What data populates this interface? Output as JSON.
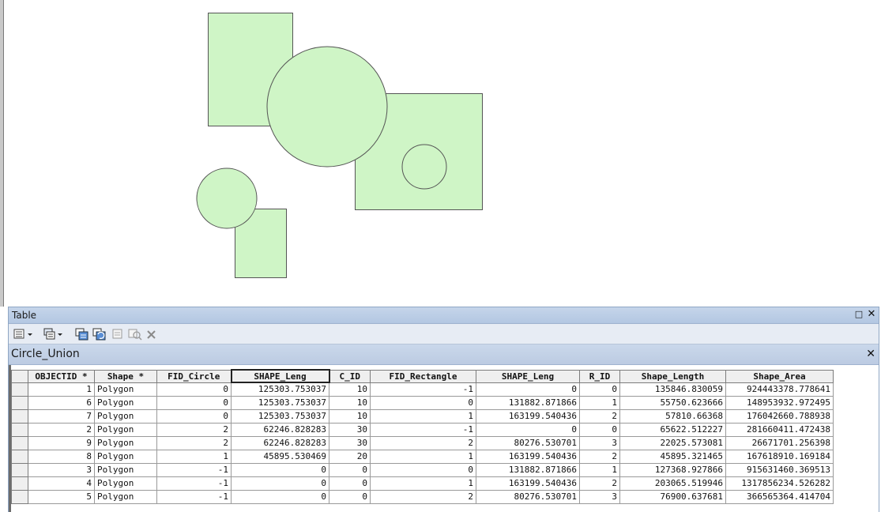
{
  "window": {
    "title": "Table",
    "maximize_glyph": "□",
    "close_glyph": "✕"
  },
  "toolbar": {
    "icons": [
      "table-options-icon",
      "related-tables-icon",
      "select-by-attributes-icon",
      "switch-selection-icon",
      "clear-selection-icon",
      "zoom-to-selected-icon",
      "delete-selected-icon"
    ]
  },
  "tab": {
    "title": "Circle_Union",
    "close_glyph": "✕"
  },
  "map": {
    "fill_color": "#cff5c6",
    "stroke_color": "#555555"
  },
  "table": {
    "columns": [
      "OBJECTID *",
      "Shape *",
      "FID_Circle",
      "SHAPE_Leng",
      "C_ID",
      "FID_Rectangle",
      "SHAPE_Leng",
      "R_ID",
      "Shape_Length",
      "Shape_Area"
    ],
    "selected_column": 3,
    "rows": [
      [
        "1",
        "Polygon",
        "0",
        "125303.753037",
        "10",
        "-1",
        "0",
        "0",
        "135846.830059",
        "924443378.778641"
      ],
      [
        "6",
        "Polygon",
        "0",
        "125303.753037",
        "10",
        "0",
        "131882.871866",
        "1",
        "55750.623666",
        "148953932.972495"
      ],
      [
        "7",
        "Polygon",
        "0",
        "125303.753037",
        "10",
        "1",
        "163199.540436",
        "2",
        "57810.66368",
        "176042660.788938"
      ],
      [
        "2",
        "Polygon",
        "2",
        "62246.828283",
        "30",
        "-1",
        "0",
        "0",
        "65622.512227",
        "281660411.472438"
      ],
      [
        "9",
        "Polygon",
        "2",
        "62246.828283",
        "30",
        "2",
        "80276.530701",
        "3",
        "22025.573081",
        "26671701.256398"
      ],
      [
        "8",
        "Polygon",
        "1",
        "45895.530469",
        "20",
        "1",
        "163199.540436",
        "2",
        "45895.321465",
        "167618910.169184"
      ],
      [
        "3",
        "Polygon",
        "-1",
        "0",
        "0",
        "0",
        "131882.871866",
        "1",
        "127368.927866",
        "915631460.369513"
      ],
      [
        "4",
        "Polygon",
        "-1",
        "0",
        "0",
        "1",
        "163199.540436",
        "2",
        "203065.519946",
        "1317856234.526282"
      ],
      [
        "5",
        "Polygon",
        "-1",
        "0",
        "0",
        "2",
        "80276.530701",
        "3",
        "76900.637681",
        "366565364.414704"
      ]
    ]
  }
}
